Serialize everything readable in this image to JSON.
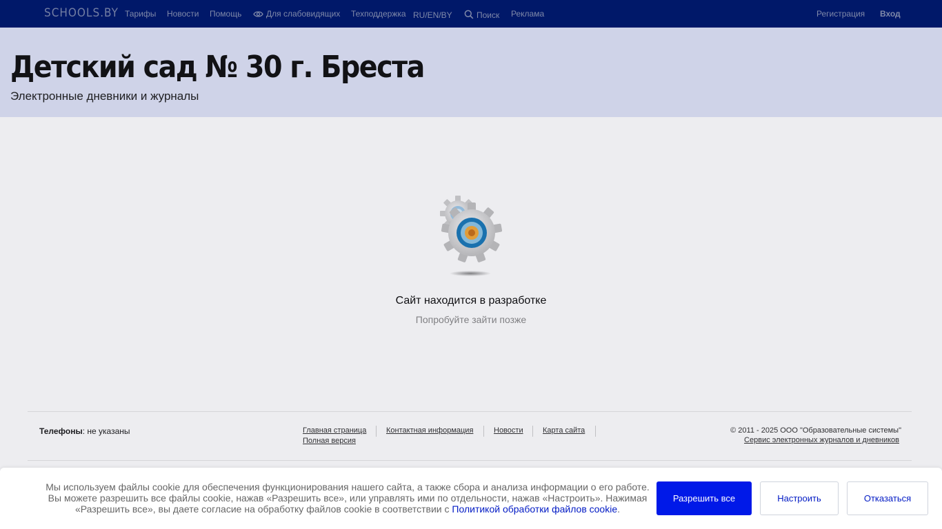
{
  "navbar": {
    "logo": "SCHOOLS.BY",
    "tariffs": "Тарифы",
    "news": "Новости",
    "help": "Помощь",
    "low_vision": "Для слабовидящих",
    "support": "Техподдержка",
    "languages": "RU/EN/BY",
    "search": "Поиск",
    "ads": "Реклама",
    "register": "Регистрация",
    "login": "Вход"
  },
  "header": {
    "title": "Детский сад № 30 г. Бреста",
    "subtitle": "Электронные дневники и журналы"
  },
  "main": {
    "status_title": "Сайт находится в разработке",
    "status_subtitle": "Попробуйте зайти позже"
  },
  "footer": {
    "phones_label": "Телефоны",
    "phones_value": ": не указаны",
    "links": [
      "Главная страница",
      "Контактная информация",
      "Новости",
      "Карта сайта",
      "Полная версия"
    ],
    "copyright": "© 2011 - 2025 ООО \"Образовательные системы\"",
    "service": "Сервис электронных журналов и дневников"
  },
  "cookie": {
    "text_line1": "Мы используем файлы cookie для обеспечения функционирования нашего сайта, а также сбора и анализа информации о его работе.",
    "text_line2": "Вы можете разрешить все файлы cookie, нажав «Разрешить все», или управлять ими по отдельности, нажав «Настроить». Нажимая",
    "text_line3": "«Разрешить все», вы даете согласие на обработку файлов cookie в соответствии с",
    "policy_link": "Политикой обработки файлов cookie",
    "period": ".",
    "allow_all": "Разрешить все",
    "configure": "Настроить",
    "decline": "Отказаться"
  },
  "colors": {
    "navbar_bg": "#001a6e",
    "header_bg": "#dfe3f7",
    "primary_button": "#0019e8",
    "link": "#0019c4"
  },
  "icons": [
    "eye-icon",
    "search-icon",
    "gear-icon"
  ]
}
